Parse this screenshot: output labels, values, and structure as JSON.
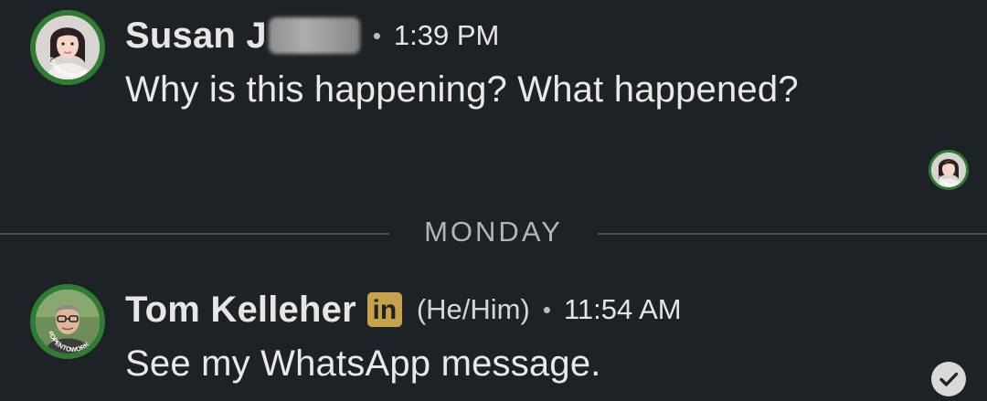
{
  "messages": [
    {
      "sender": "Susan J",
      "separator": "•",
      "time": "1:39 PM",
      "text": "Why is this happening? What happened?",
      "avatar_badge": "#OPENTOWORK"
    },
    {
      "sender": "Tom Kelleher",
      "badge": "in",
      "pronouns": "(He/Him)",
      "separator": "•",
      "time": "11:54 AM",
      "text": "See my WhatsApp message.",
      "avatar_badge": "#OPENTOWORK"
    }
  ],
  "divider": {
    "label": "MONDAY"
  },
  "read_receipt": {
    "avatar_badge": "#OPENTOWORK",
    "icon": "avatar-read-receipt"
  },
  "status": {
    "icon": "check-circle-icon"
  },
  "colors": {
    "background": "#1d2226",
    "open_to_work_ring": "#2e7d32",
    "linkedin_badge": "#c8a24b",
    "divider": "#4a4f54"
  }
}
